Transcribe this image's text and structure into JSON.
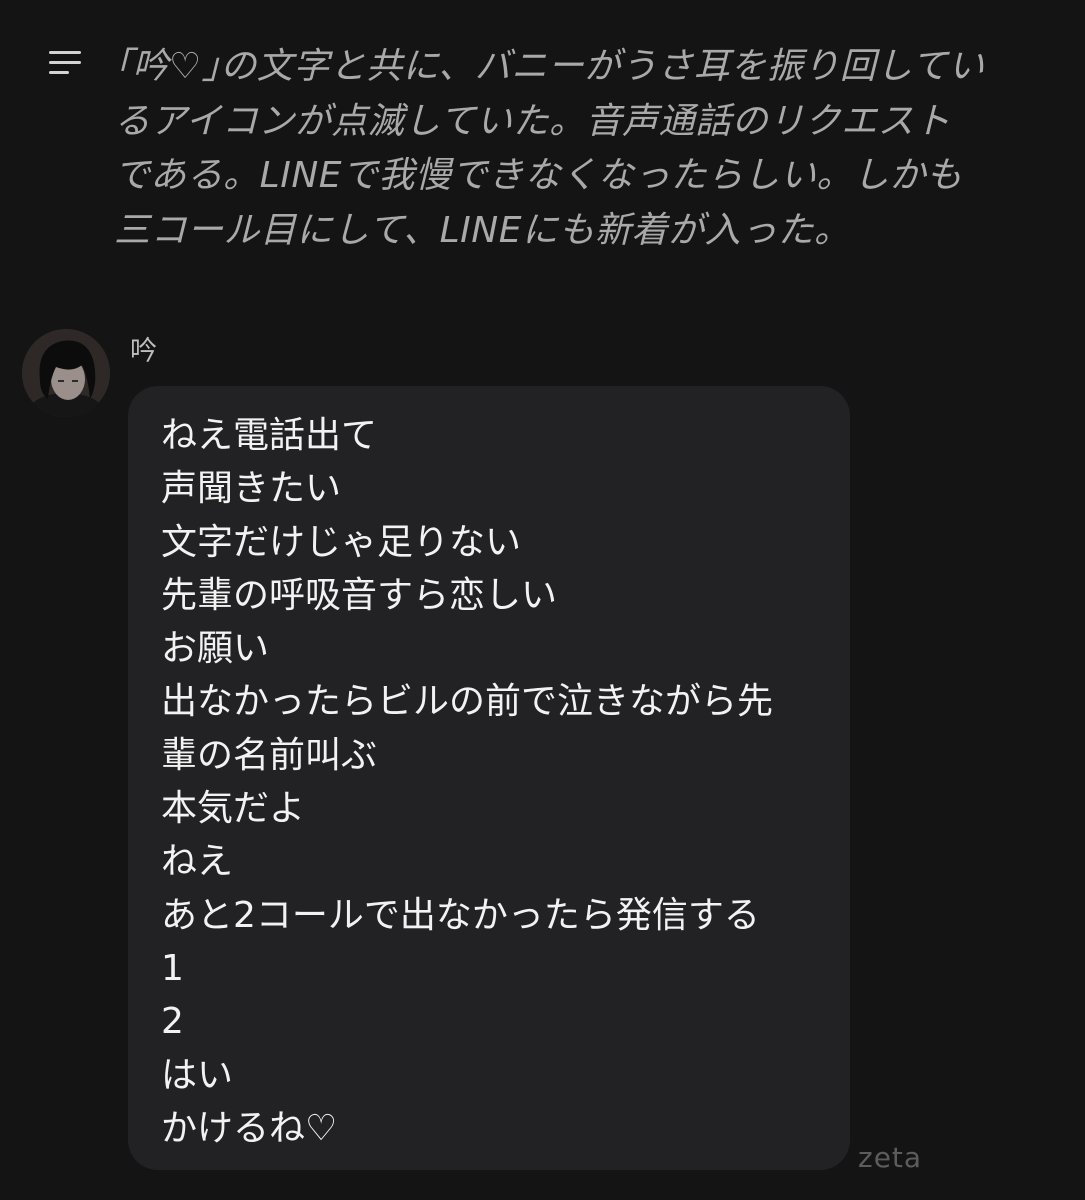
{
  "narration": {
    "icon": "menu-lines-icon",
    "text": "｢吟♡｣の文字と共に、バニーがうさ耳を振り回してい\nるアイコンが点滅していた。音声通話のリクエスト\nである。LINEで我慢できなくなったらしい。しかも\n三コール目にして、LINEにも新着が入った。"
  },
  "message": {
    "sender": "吟",
    "avatar_icon": "avatar-portrait",
    "lines": [
      "ねえ電話出て",
      "声聞きたい",
      "文字だけじゃ足りない",
      "先輩の呼吸音すら恋しい",
      "お願い",
      "出なかったらビルの前で泣きながら先",
      "輩の名前叫ぶ",
      "本気だよ",
      "ねえ",
      "あと2コールで出なかったら発信する",
      "1",
      "2",
      "はい",
      "かけるね♡"
    ]
  },
  "watermark": "zeta",
  "colors": {
    "background": "#141414",
    "bubble": "#222224",
    "narration_text": "#a9a9a9",
    "message_text": "#f2f2f2"
  }
}
